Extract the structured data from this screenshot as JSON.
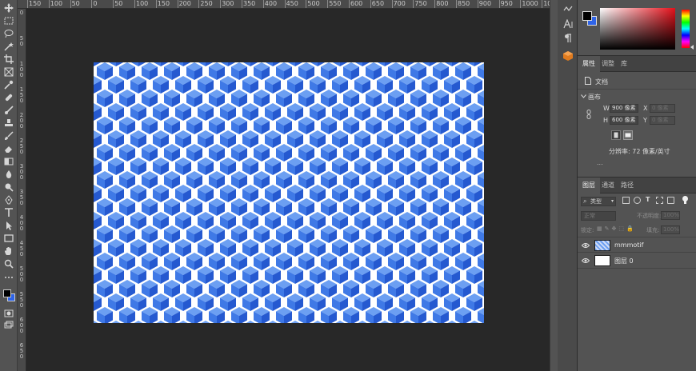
{
  "colors": {
    "foreground": "#000000",
    "background": "#2f64e8",
    "cube_light": "#6c9ff2",
    "cube_mid": "#3f79e6",
    "cube_dark": "#2559d0"
  },
  "ruler": {
    "top_labels": [
      "150",
      "100",
      "50",
      "0",
      "50",
      "100",
      "150",
      "200",
      "250",
      "300",
      "350",
      "400",
      "450",
      "500",
      "550",
      "600",
      "650",
      "700",
      "750",
      "800",
      "850",
      "900",
      "950",
      "1000",
      "1050"
    ],
    "left_labels": [
      "0",
      "50",
      "100",
      "150",
      "200",
      "250",
      "300",
      "350",
      "400",
      "450",
      "500",
      "550",
      "600",
      "650"
    ]
  },
  "tools": [
    "move-icon",
    "marquee-icon",
    "lasso-icon",
    "magic-wand-icon",
    "crop-icon",
    "frame-icon",
    "eyedropper-icon",
    "healing-icon",
    "brush-icon",
    "stamp-icon",
    "history-brush-icon",
    "eraser-icon",
    "gradient-icon",
    "blur-icon",
    "dodge-icon",
    "pen-icon",
    "type-icon",
    "path-select-icon",
    "rectangle-icon",
    "hand-icon",
    "zoom-icon"
  ],
  "panel_tabs": {
    "properties": [
      "属性",
      "调整",
      "库"
    ],
    "layers": [
      "图层",
      "通道",
      "路径"
    ]
  },
  "properties": {
    "doc_label": "文档",
    "canvas_label": "画布",
    "w_label": "W",
    "w_value": "900 像素",
    "h_label": "H",
    "h_value": "600 像素",
    "x_label": "X",
    "x_value": "0 像素",
    "y_label": "Y",
    "y_value": "0 像素",
    "resolution": "分辨率: 72 像素/英寸",
    "more": "..."
  },
  "layers_panel": {
    "filter_kind": "类型",
    "blend_mode": "正常",
    "opacity_label": "不透明度:",
    "opacity_value": "100%",
    "lock_label": "锁定:",
    "fill_label": "填充:",
    "fill_value": "100%",
    "layers": [
      {
        "name": "mmmotif"
      },
      {
        "name": "图层 0"
      }
    ]
  }
}
